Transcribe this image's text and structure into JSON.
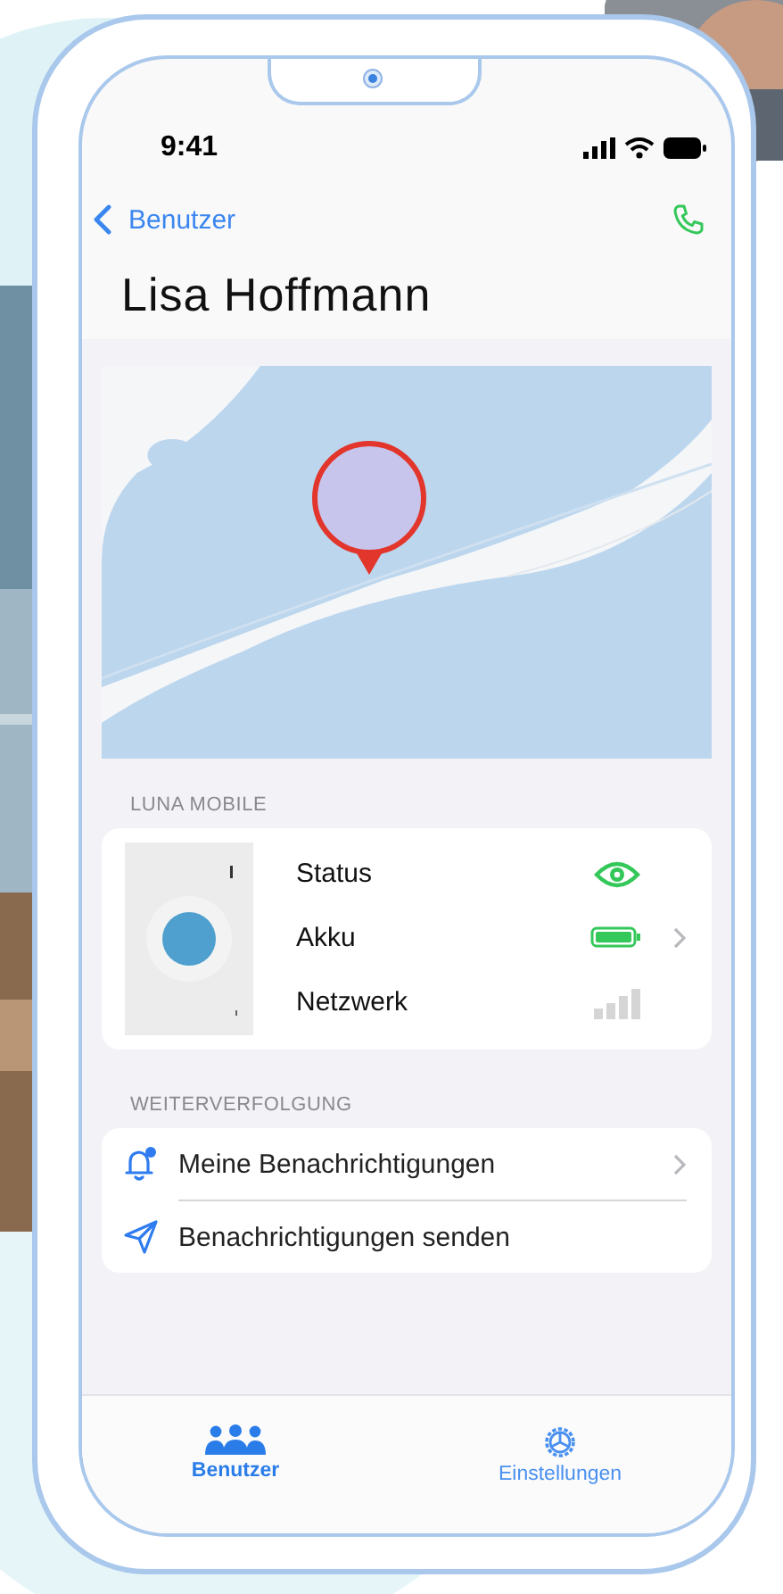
{
  "status_bar": {
    "time": "9:41"
  },
  "nav": {
    "back": "Benutzer"
  },
  "title": "Lisa Hoffmann",
  "device_section": {
    "heading": "LUNA MOBILE",
    "rows": [
      {
        "kind": "status",
        "label": "Status",
        "chevron": false
      },
      {
        "kind": "battery",
        "label": "Akku",
        "chevron": true
      },
      {
        "kind": "network",
        "label": "Netzwerk",
        "chevron": false
      }
    ]
  },
  "tracking_section": {
    "heading": "WEITERVERFOLGUNG",
    "rows": [
      {
        "kind": "bell",
        "label": "Meine Benachrichtigungen",
        "chevron": true
      },
      {
        "kind": "send",
        "label": "Benachrichtigungen senden",
        "chevron": false
      }
    ]
  },
  "tab_bar": [
    {
      "kind": "users",
      "label": "Benutzer",
      "selected": true
    },
    {
      "kind": "settings",
      "label": "Einstellungen",
      "selected": false
    }
  ]
}
